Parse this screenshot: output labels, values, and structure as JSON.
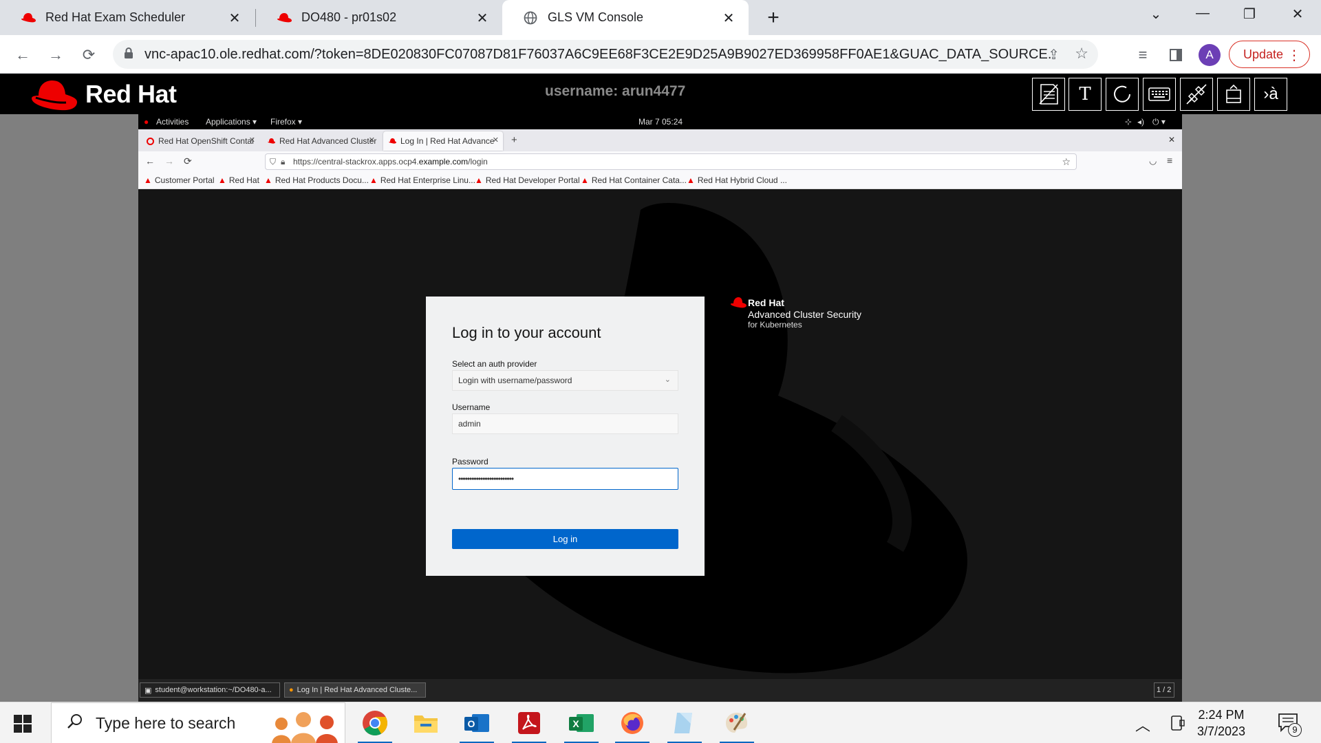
{
  "chrome": {
    "tabs": [
      {
        "label": "Red Hat Exam Scheduler",
        "active": false
      },
      {
        "label": "DO480 - pr01s02",
        "active": false
      },
      {
        "label": "GLS VM Console",
        "active": true
      }
    ],
    "url": "vnc-apac10.ole.redhat.com/?token=8DE020830FC07087D81F76037A6C9EE68F3CE2E9D25A9B9027ED369958FF0AE1&GUAC_DATA_SOURCE...",
    "avatar_letter": "A",
    "update_label": "Update"
  },
  "gls": {
    "brand": "Red Hat",
    "username": "username: arun4477",
    "buttons": [
      "notes",
      "text",
      "refresh",
      "keyboard",
      "disconnect",
      "eject",
      "language"
    ]
  },
  "gnome": {
    "activities": "Activities",
    "applications": "Applications ▾",
    "firefox": "Firefox ▾",
    "clock": "Mar 7  05:24"
  },
  "firefox": {
    "tabs": [
      {
        "label": "Red Hat OpenShift Contai",
        "active": false
      },
      {
        "label": "Red Hat Advanced Cluster",
        "active": false
      },
      {
        "label": "Log In | Red Hat Advance",
        "active": true
      }
    ],
    "url_prefix": "https://central-stackrox.apps.ocp4.",
    "url_domain": "example.com",
    "url_suffix": "/login",
    "bookmarks": [
      "Customer Portal",
      "Red Hat",
      "Red Hat Products Docu...",
      "Red Hat Enterprise Linu...",
      "Red Hat Developer Portal",
      "Red Hat Container Cata...",
      "Red Hat Hybrid Cloud ..."
    ]
  },
  "login": {
    "title": "Log in to your account",
    "auth_label": "Select an auth provider",
    "auth_value": "Login with username/password",
    "username_label": "Username",
    "username_value": "admin",
    "password_label": "Password",
    "password_value": "•••••••••••••••••••••••••",
    "button": "Log in",
    "brand_line1": "Red Hat",
    "brand_line2": "Advanced Cluster Security",
    "brand_line3": "for Kubernetes"
  },
  "vm_taskbar": {
    "items": [
      "student@workstation:~/DO480-a...",
      "Log In | Red Hat Advanced Cluste..."
    ],
    "workspace": "1 / 2"
  },
  "windows": {
    "search_placeholder": "Type here to search",
    "time": "2:24 PM",
    "date": "3/7/2023",
    "notifications": "9"
  },
  "colors": {
    "redhat_red": "#ee0000",
    "login_blue": "#0066cc",
    "update_red": "#d93025"
  }
}
